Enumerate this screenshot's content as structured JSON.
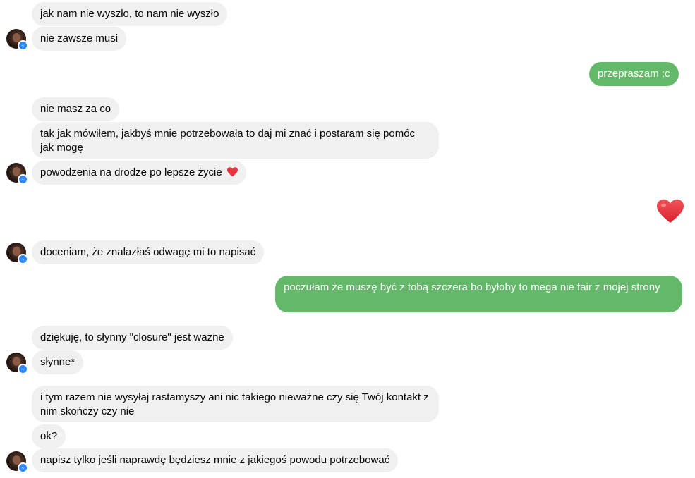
{
  "messages": {
    "m1": "jak nam nie wyszło, to nam nie wyszło",
    "m2": "nie zawsze musi",
    "m3": "przepraszam :c",
    "m4": "nie masz za co",
    "m5": "tak jak mówiłem, jakbyś mnie potrzebowała to daj mi znać i postaram się pomóc jak mogę",
    "m6": "powodzenia na drodze po lepsze życie",
    "m7": "doceniam, że znalazłaś odwagę mi to napisać",
    "m8": "poczułam że muszę być z tobą szczera bo byłoby to mega nie fair z mojej strony",
    "m9": "dziękuję, to słynny \"closure\" jest ważne",
    "m10": "słynne*",
    "m11": "i tym razem nie wysyłaj rastamyszy ani nic takiego nieważne czy się Twój kontakt z nim skończy czy nie",
    "m12": "ok?",
    "m13": "napisz tylko jeśli naprawdę będziesz mnie z jakiegoś powodu potrzebować"
  },
  "icons": {
    "avatar": "contact-avatar",
    "badge": "messenger-badge-icon",
    "heart": "heart-icon"
  },
  "colors": {
    "incoming_bubble": "#f0f0f0",
    "outgoing_bubble": "#64b869",
    "heart": "#e8343e",
    "messenger_badge": "#2d88ff"
  }
}
